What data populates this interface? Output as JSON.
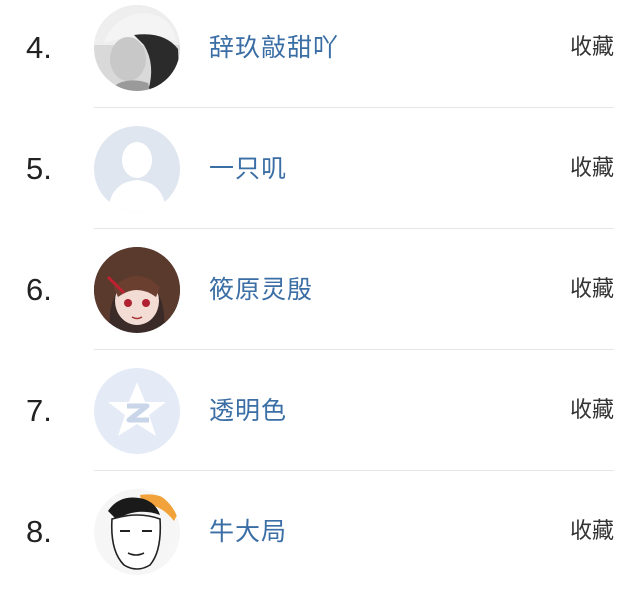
{
  "users": [
    {
      "rank": "4.",
      "name": "辞玖敲甜吖",
      "action": "收藏",
      "avatar": "avatar-girl-cap-icon"
    },
    {
      "rank": "5.",
      "name": "一只叽",
      "action": "收藏",
      "avatar": "avatar-default-person-icon"
    },
    {
      "rank": "6.",
      "name": "筱原灵殷",
      "action": "收藏",
      "avatar": "avatar-anime-girl-icon"
    },
    {
      "rank": "7.",
      "name": "透明色",
      "action": "收藏",
      "avatar": "avatar-qq-star-icon"
    },
    {
      "rank": "8.",
      "name": "牛大局",
      "action": "收藏",
      "avatar": "avatar-cartoon-man-icon"
    }
  ],
  "colors": {
    "name": "#3a6ea5",
    "divider": "#e6e6e6",
    "default_avatar": "#dfe6f0"
  }
}
